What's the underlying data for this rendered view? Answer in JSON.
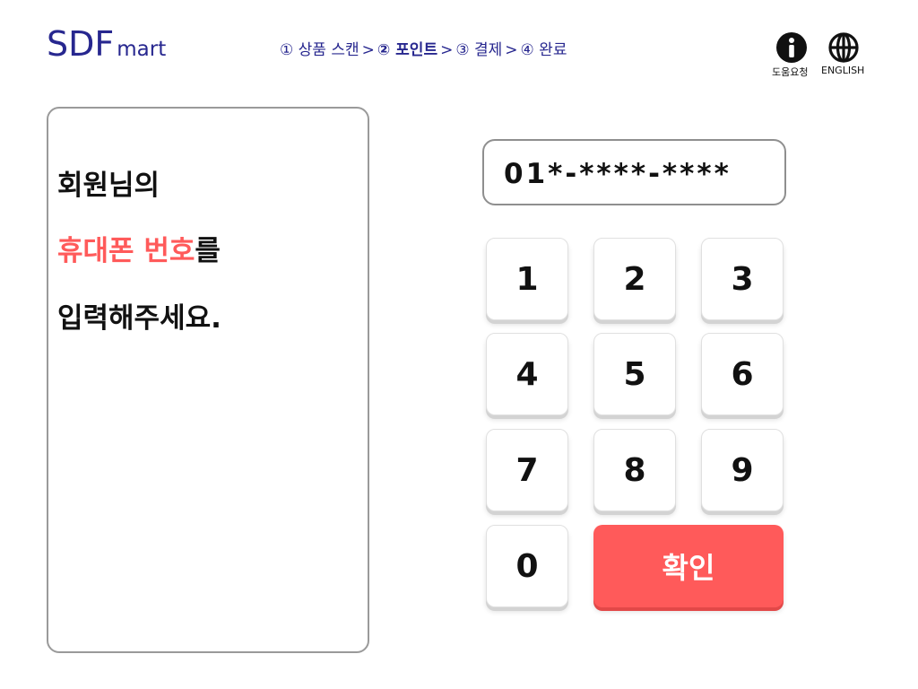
{
  "header": {
    "logo_big": "SDF",
    "logo_small": "mart",
    "steps": [
      {
        "label": "① 상품 스캔"
      },
      {
        "label": "② 포인트"
      },
      {
        "label": "③ 결제"
      },
      {
        "label": "④ 완료"
      }
    ],
    "step_separator": ">",
    "help_label": "도움요청",
    "english_label": "ENGLISH"
  },
  "instruction": {
    "line1": "회원님의",
    "line2_accent": "휴대폰 번호",
    "line2_rest": "를",
    "line3": "입력해주세요."
  },
  "phone_display": {
    "value": "01*-****-****"
  },
  "keypad": {
    "keys": [
      "1",
      "2",
      "3",
      "4",
      "5",
      "6",
      "7",
      "8",
      "9",
      "0"
    ],
    "confirm_label": "확인"
  },
  "colors": {
    "brand": "#27278f",
    "accent": "#ff5a5a"
  }
}
